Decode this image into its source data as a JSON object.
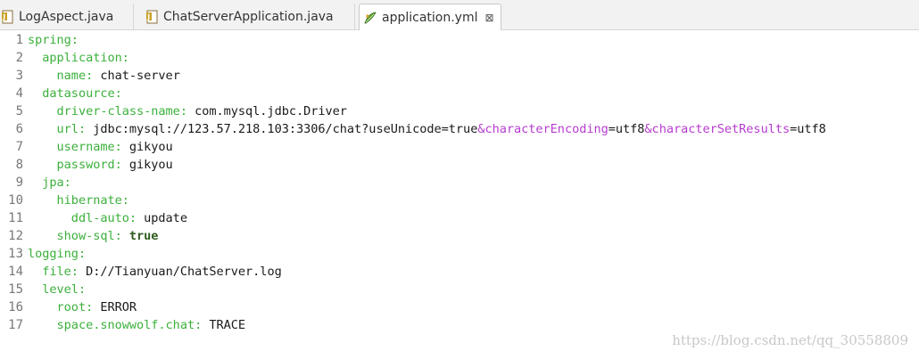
{
  "tabs": [
    {
      "label": "LogAspect.java",
      "icon": "java-file-icon",
      "active": false
    },
    {
      "label": "ChatServerApplication.java",
      "icon": "java-file-icon",
      "active": false
    },
    {
      "label": "application.yml",
      "icon": "yaml-file-icon",
      "active": true,
      "close": "⊠"
    }
  ],
  "lines": [
    {
      "n": "1",
      "parts": [
        {
          "t": "spring:",
          "c": "k"
        }
      ]
    },
    {
      "n": "2",
      "parts": [
        {
          "t": "  application:",
          "c": "k"
        }
      ]
    },
    {
      "n": "3",
      "parts": [
        {
          "t": "    name:",
          "c": "k"
        },
        {
          "t": " chat-server",
          "c": "v"
        }
      ]
    },
    {
      "n": "4",
      "parts": [
        {
          "t": "  datasource:",
          "c": "k"
        }
      ]
    },
    {
      "n": "5",
      "parts": [
        {
          "t": "    driver-class-name:",
          "c": "k"
        },
        {
          "t": " com.mysql.jdbc.Driver",
          "c": "v"
        }
      ]
    },
    {
      "n": "6",
      "parts": [
        {
          "t": "    url:",
          "c": "k"
        },
        {
          "t": " jdbc:mysql://123.57.218.103:3306/chat?useUnicode=true",
          "c": "v"
        },
        {
          "t": "&characterEncoding",
          "c": "p"
        },
        {
          "t": "=utf8",
          "c": "v"
        },
        {
          "t": "&characterSetResults",
          "c": "p"
        },
        {
          "t": "=utf8",
          "c": "v"
        }
      ]
    },
    {
      "n": "7",
      "parts": [
        {
          "t": "    username:",
          "c": "k"
        },
        {
          "t": " gikyou",
          "c": "v"
        }
      ]
    },
    {
      "n": "8",
      "parts": [
        {
          "t": "    password:",
          "c": "k"
        },
        {
          "t": " gikyou",
          "c": "v"
        }
      ]
    },
    {
      "n": "9",
      "parts": [
        {
          "t": "  jpa:",
          "c": "k"
        }
      ]
    },
    {
      "n": "10",
      "parts": [
        {
          "t": "    hibernate:",
          "c": "k"
        }
      ]
    },
    {
      "n": "11",
      "parts": [
        {
          "t": "      ddl-auto:",
          "c": "k"
        },
        {
          "t": " update",
          "c": "v"
        }
      ]
    },
    {
      "n": "12",
      "parts": [
        {
          "t": "    show-sql:",
          "c": "k"
        },
        {
          "t": " true",
          "c": "b"
        }
      ]
    },
    {
      "n": "13",
      "parts": [
        {
          "t": "logging:",
          "c": "k"
        }
      ]
    },
    {
      "n": "14",
      "parts": [
        {
          "t": "  file:",
          "c": "k"
        },
        {
          "t": " D://Tianyuan/ChatServer.log",
          "c": "v"
        }
      ]
    },
    {
      "n": "15",
      "parts": [
        {
          "t": "  level:",
          "c": "k"
        }
      ]
    },
    {
      "n": "16",
      "parts": [
        {
          "t": "    root:",
          "c": "k"
        },
        {
          "t": " ERROR",
          "c": "v"
        }
      ]
    },
    {
      "n": "17",
      "parts": [
        {
          "t": "    space.snowwolf.chat:",
          "c": "k"
        },
        {
          "t": " TRACE",
          "c": "v"
        }
      ]
    }
  ],
  "watermark": "https://blog.csdn.net/qq_30558809",
  "colors": {
    "key": "#3bb03b",
    "value": "#1a1a1a",
    "param": "#b63ccf",
    "boolean": "#2e5c1e"
  }
}
